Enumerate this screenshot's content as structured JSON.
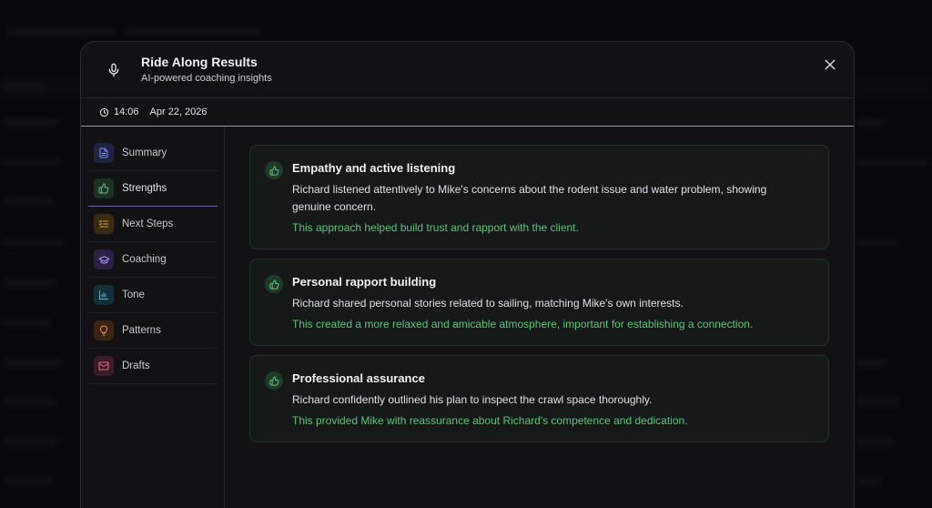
{
  "modal": {
    "title": "Ride Along Results",
    "subtitle": "AI-powered coaching insights",
    "time": "14:06",
    "date": "Apr 22, 2026"
  },
  "icons": {
    "header": "microphone-icon",
    "close": "close-icon",
    "time": "clock-icon",
    "card": "thumbs-up-icon"
  },
  "sidebar": {
    "items": [
      {
        "label": "Summary",
        "icon": "document-icon",
        "color": "#7b8cf0",
        "bg": "#1e2440"
      },
      {
        "label": "Strengths",
        "icon": "thumbs-up-icon",
        "color": "#5dc27e",
        "bg": "#1a3324",
        "active": true
      },
      {
        "label": "Next Steps",
        "icon": "list-check-icon",
        "color": "#e0a23a",
        "bg": "#3a2c12"
      },
      {
        "label": "Coaching",
        "icon": "graduation-cap-icon",
        "color": "#a88cf0",
        "bg": "#2a2142"
      },
      {
        "label": "Tone",
        "icon": "bar-chart-icon",
        "color": "#4fb8d8",
        "bg": "#13303a"
      },
      {
        "label": "Patterns",
        "icon": "lightbulb-icon",
        "color": "#e88a4a",
        "bg": "#3a2414"
      },
      {
        "label": "Drafts",
        "icon": "mail-icon",
        "color": "#e0708a",
        "bg": "#3a1a24"
      }
    ]
  },
  "colors": {
    "accent": "#6f63d6",
    "impact": "#5dc27e"
  },
  "strengths": [
    {
      "title": "Empathy and active listening",
      "description": "Richard listened attentively to Mike's concerns about the rodent issue and water problem, showing genuine concern.",
      "impact": "This approach helped build trust and rapport with the client."
    },
    {
      "title": "Personal rapport building",
      "description": "Richard shared personal stories related to sailing, matching Mike's own interests.",
      "impact": "This created a more relaxed and amicable atmosphere, important for establishing a connection."
    },
    {
      "title": "Professional assurance",
      "description": "Richard confidently outlined his plan to inspect the crawl space thoroughly.",
      "impact": "This provided Mike with reassurance about Richard's competence and dedication."
    }
  ]
}
